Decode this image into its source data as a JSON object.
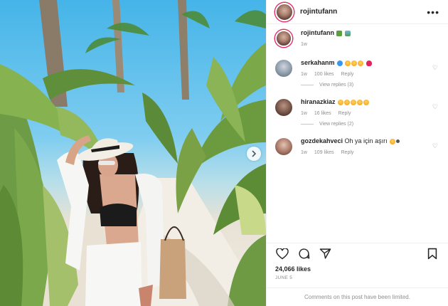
{
  "post": {
    "author": "rojintufann",
    "more_label": "•••",
    "likes": "24,066 likes",
    "date": "JUNE 5",
    "comments_limited": "Comments on this post have been limited."
  },
  "caption": {
    "username": "rojintufann",
    "time": "1w"
  },
  "comments": [
    {
      "username": "serkahanm",
      "text": "",
      "time": "1w",
      "likes": "100 likes",
      "reply": "Reply",
      "view_replies": "View replies (3)"
    },
    {
      "username": "hiranazkiaz",
      "text": "",
      "time": "1w",
      "likes": "16 likes",
      "reply": "Reply",
      "view_replies": "View replies (2)"
    },
    {
      "username": "gozdekahveci",
      "text": "Oh ya için aşırı",
      "time": "1w",
      "likes": "109 likes",
      "reply": "Reply"
    }
  ],
  "icons": {
    "heart": "heart-icon",
    "comment": "comment-icon",
    "share": "share-icon",
    "bookmark": "bookmark-icon",
    "next": "chevron-right-icon"
  },
  "colors": {
    "story_ring": "#e1306c",
    "text": "#262626",
    "muted": "#8e8e8e",
    "divider": "#efefef"
  }
}
